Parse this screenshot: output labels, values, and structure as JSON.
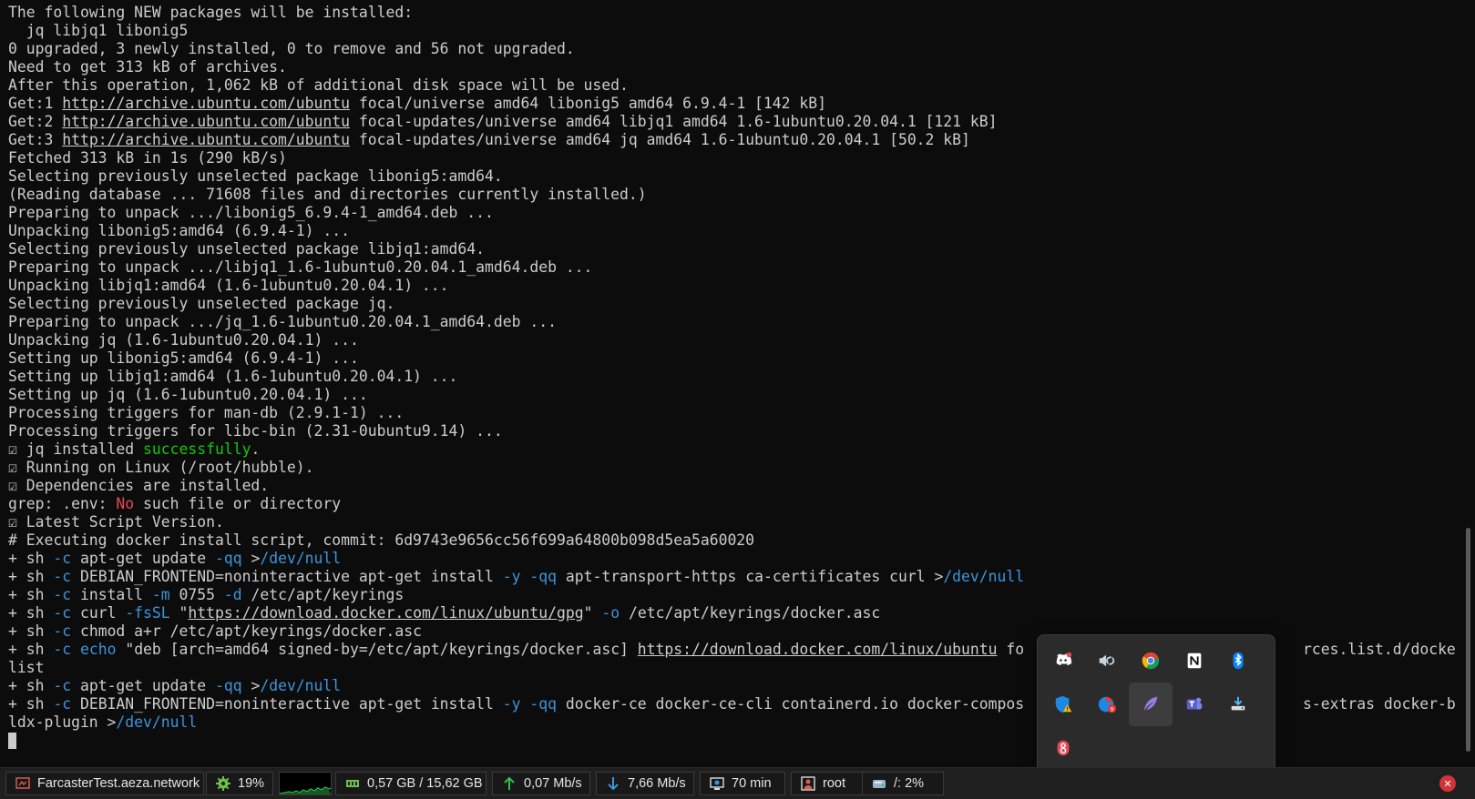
{
  "terminal": {
    "lines": [
      [
        {
          "t": "The following NEW packages will be installed:"
        }
      ],
      [
        {
          "t": "  jq libjq1 libonig5"
        }
      ],
      [
        {
          "t": "0 upgraded, 3 newly installed, 0 to remove and 56 not upgraded."
        }
      ],
      [
        {
          "t": "Need to get 313 kB of archives."
        }
      ],
      [
        {
          "t": "After this operation, 1,062 kB of additional disk space will be used."
        }
      ],
      [
        {
          "t": "Get:1 "
        },
        {
          "t": "http://archive.ubuntu.com/ubuntu",
          "s": "url"
        },
        {
          "t": " focal/universe amd64 libonig5 amd64 6.9.4-1 [142 kB]"
        }
      ],
      [
        {
          "t": "Get:2 "
        },
        {
          "t": "http://archive.ubuntu.com/ubuntu",
          "s": "url"
        },
        {
          "t": " focal-updates/universe amd64 libjq1 amd64 1.6-1ubuntu0.20.04.1 [121 kB]"
        }
      ],
      [
        {
          "t": "Get:3 "
        },
        {
          "t": "http://archive.ubuntu.com/ubuntu",
          "s": "url"
        },
        {
          "t": " focal-updates/universe amd64 jq amd64 1.6-1ubuntu0.20.04.1 [50.2 kB]"
        }
      ],
      [
        {
          "t": "Fetched 313 kB in 1s (290 kB/s)"
        }
      ],
      [
        {
          "t": "Selecting previously unselected package libonig5:amd64."
        }
      ],
      [
        {
          "t": "(Reading database ... 71608 files and directories currently installed.)"
        }
      ],
      [
        {
          "t": "Preparing to unpack .../libonig5_6.9.4-1_amd64.deb ..."
        }
      ],
      [
        {
          "t": "Unpacking libonig5:amd64 (6.9.4-1) ..."
        }
      ],
      [
        {
          "t": "Selecting previously unselected package libjq1:amd64."
        }
      ],
      [
        {
          "t": "Preparing to unpack .../libjq1_1.6-1ubuntu0.20.04.1_amd64.deb ..."
        }
      ],
      [
        {
          "t": "Unpacking libjq1:amd64 (1.6-1ubuntu0.20.04.1) ..."
        }
      ],
      [
        {
          "t": "Selecting previously unselected package jq."
        }
      ],
      [
        {
          "t": "Preparing to unpack .../jq_1.6-1ubuntu0.20.04.1_amd64.deb ..."
        }
      ],
      [
        {
          "t": "Unpacking jq (1.6-1ubuntu0.20.04.1) ..."
        }
      ],
      [
        {
          "t": "Setting up libonig5:amd64 (6.9.4-1) ..."
        }
      ],
      [
        {
          "t": "Setting up libjq1:amd64 (1.6-1ubuntu0.20.04.1) ..."
        }
      ],
      [
        {
          "t": "Setting up jq (1.6-1ubuntu0.20.04.1) ..."
        }
      ],
      [
        {
          "t": "Processing triggers for man-db (2.9.1-1) ..."
        }
      ],
      [
        {
          "t": "Processing triggers for libc-bin (2.31-0ubuntu9.14) ..."
        }
      ],
      [
        {
          "t": "☑ jq installed "
        },
        {
          "t": "successfully",
          "s": "green"
        },
        {
          "t": "."
        }
      ],
      [
        {
          "t": "☑ Running on Linux (/root/hubble)."
        }
      ],
      [
        {
          "t": "☑ Dependencies are installed."
        }
      ],
      [
        {
          "t": "grep: .env: "
        },
        {
          "t": "No",
          "s": "red"
        },
        {
          "t": " such file or directory"
        }
      ],
      [
        {
          "t": "☑ Latest Script Version."
        }
      ],
      [
        {
          "t": "# Executing docker install script, commit: 6d9743e9656cc56f699a64800b098d5ea5a60020"
        }
      ],
      [
        {
          "t": "+ sh "
        },
        {
          "t": "-c",
          "s": "cyan"
        },
        {
          "t": " apt-get update "
        },
        {
          "t": "-qq",
          "s": "cyan"
        },
        {
          "t": " >"
        },
        {
          "t": "/dev/null",
          "s": "cyan"
        }
      ],
      [
        {
          "t": "+ sh "
        },
        {
          "t": "-c",
          "s": "cyan"
        },
        {
          "t": " DEBIAN_FRONTEND=noninteractive apt-get install "
        },
        {
          "t": "-y -qq",
          "s": "cyan"
        },
        {
          "t": " apt-transport-https ca-certificates curl >"
        },
        {
          "t": "/dev/null",
          "s": "cyan"
        }
      ],
      [
        {
          "t": "+ sh "
        },
        {
          "t": "-c",
          "s": "cyan"
        },
        {
          "t": " install "
        },
        {
          "t": "-m",
          "s": "cyan"
        },
        {
          "t": " 0755 "
        },
        {
          "t": "-d",
          "s": "cyan"
        },
        {
          "t": " /etc/apt/keyrings"
        }
      ],
      [
        {
          "t": "+ sh "
        },
        {
          "t": "-c",
          "s": "cyan"
        },
        {
          "t": " curl "
        },
        {
          "t": "-fsSL",
          "s": "cyan"
        },
        {
          "t": " \""
        },
        {
          "t": "https://download.docker.com/linux/ubuntu/gpg",
          "s": "url"
        },
        {
          "t": "\" "
        },
        {
          "t": "-o",
          "s": "cyan"
        },
        {
          "t": " /etc/apt/keyrings/docker.asc"
        }
      ],
      [
        {
          "t": "+ sh "
        },
        {
          "t": "-c",
          "s": "cyan"
        },
        {
          "t": " chmod a+r /etc/apt/keyrings/docker.asc"
        }
      ],
      [
        {
          "t": "+ sh "
        },
        {
          "t": "-c",
          "s": "cyan"
        },
        {
          "t": " "
        },
        {
          "t": "echo",
          "s": "cyan"
        },
        {
          "t": " \"deb [arch=amd64 signed-by=/etc/apt/keyrings/docker.asc] "
        },
        {
          "t": "https://download.docker.com/linux/ubuntu",
          "s": "url"
        },
        {
          "t": " fo                               rces.list.d/docker."
        }
      ],
      [
        {
          "t": "list"
        }
      ],
      [
        {
          "t": "+ sh "
        },
        {
          "t": "-c",
          "s": "cyan"
        },
        {
          "t": " apt-get update "
        },
        {
          "t": "-qq",
          "s": "cyan"
        },
        {
          "t": " >"
        },
        {
          "t": "/dev/null",
          "s": "cyan"
        }
      ],
      [
        {
          "t": "+ sh "
        },
        {
          "t": "-c",
          "s": "cyan"
        },
        {
          "t": " DEBIAN_FRONTEND=noninteractive apt-get install "
        },
        {
          "t": "-y -qq",
          "s": "cyan"
        },
        {
          "t": " docker-ce docker-ce-cli containerd.io docker-compos                               s-extras docker-bui"
        }
      ],
      [
        {
          "t": "ldx-plugin >"
        },
        {
          "t": "/dev/null",
          "s": "cyan"
        }
      ]
    ]
  },
  "tray": {
    "icons": [
      {
        "name": "discord-icon",
        "color": "#5865f2",
        "selected": false
      },
      {
        "name": "steam-icon",
        "color": "#c7d5e0",
        "selected": false
      },
      {
        "name": "chrome-icon",
        "color": "#4285f4",
        "selected": false
      },
      {
        "name": "notion-icon",
        "color": "#ffffff",
        "selected": false
      },
      {
        "name": "bluetooth-icon",
        "color": "#0a84ff",
        "selected": false
      },
      {
        "name": "windows-security-warning-icon",
        "color": "#1e88e5",
        "selected": false
      },
      {
        "name": "browser-notification-icon",
        "color": "#e53935",
        "selected": false
      },
      {
        "name": "feather-icon",
        "color": "#9c7be8",
        "selected": true
      },
      {
        "name": "teams-icon",
        "color": "#5b5fc7",
        "selected": false
      },
      {
        "name": "network-drive-icon",
        "color": "#dddddd",
        "selected": false
      },
      {
        "name": "gamebar-icon",
        "color": "#e74856",
        "selected": false
      }
    ],
    "badge_text": "9"
  },
  "statusbar": {
    "host": "FarcasterTest.aeza.network",
    "cpu": "19%",
    "memory": "0,57 GB / 15,62 GB",
    "upload": "0,07 Mb/s",
    "download": "7,66 Mb/s",
    "uptime": "70 min",
    "user": "root",
    "disk": "/: 2%",
    "close_label": "✕"
  },
  "colors": {
    "background": "#0c0c0c",
    "foreground": "#cccccc",
    "cyan": "#3a96dd",
    "green": "#16c60c",
    "red": "#e74856",
    "statusbar_bg": "#1f1f1f"
  }
}
